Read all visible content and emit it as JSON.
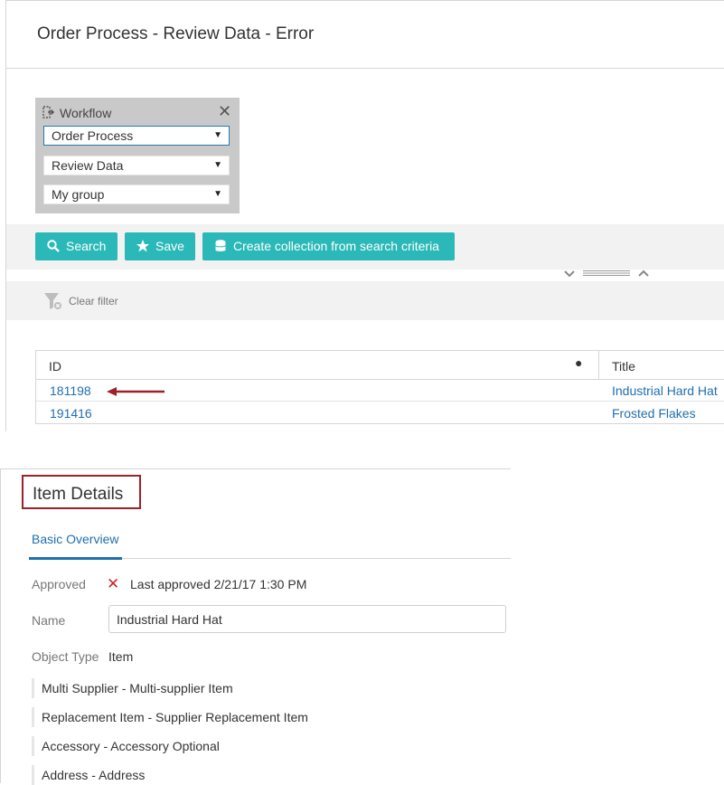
{
  "page": {
    "title": "Order Process - Review Data - Error"
  },
  "workflow": {
    "label": "Workflow",
    "icon": "workflow-icon",
    "close_icon": "close-icon",
    "selects": [
      {
        "value": "Order Process"
      },
      {
        "value": "Review Data"
      },
      {
        "value": "My group"
      }
    ]
  },
  "toolbar": {
    "search_label": "Search",
    "save_label": "Save",
    "create_collection_label": "Create collection from search criteria",
    "accent_color": "#2bb8b8"
  },
  "filter": {
    "clear_label": "Clear filter"
  },
  "grid": {
    "columns": [
      "ID",
      "Title"
    ],
    "rows": [
      {
        "id": "181198",
        "title": "Industrial Hard Hat"
      },
      {
        "id": "191416",
        "title": "Frosted Flakes"
      }
    ]
  },
  "item_details": {
    "title": "Item Details",
    "tab": "Basic Overview",
    "approved_label": "Approved",
    "approved_status": "Last approved 2/21/17 1:30 PM",
    "name_label": "Name",
    "name_value": "Industrial Hard Hat",
    "object_type_label": "Object Type",
    "object_type_value": "Item",
    "references": [
      "Multi Supplier - Multi-supplier Item",
      "Replacement Item - Supplier Replacement Item",
      "Accessory - Accessory Optional",
      "Address - Address"
    ],
    "highlight_color": "#9b2226",
    "error_color": "#d0232b"
  }
}
